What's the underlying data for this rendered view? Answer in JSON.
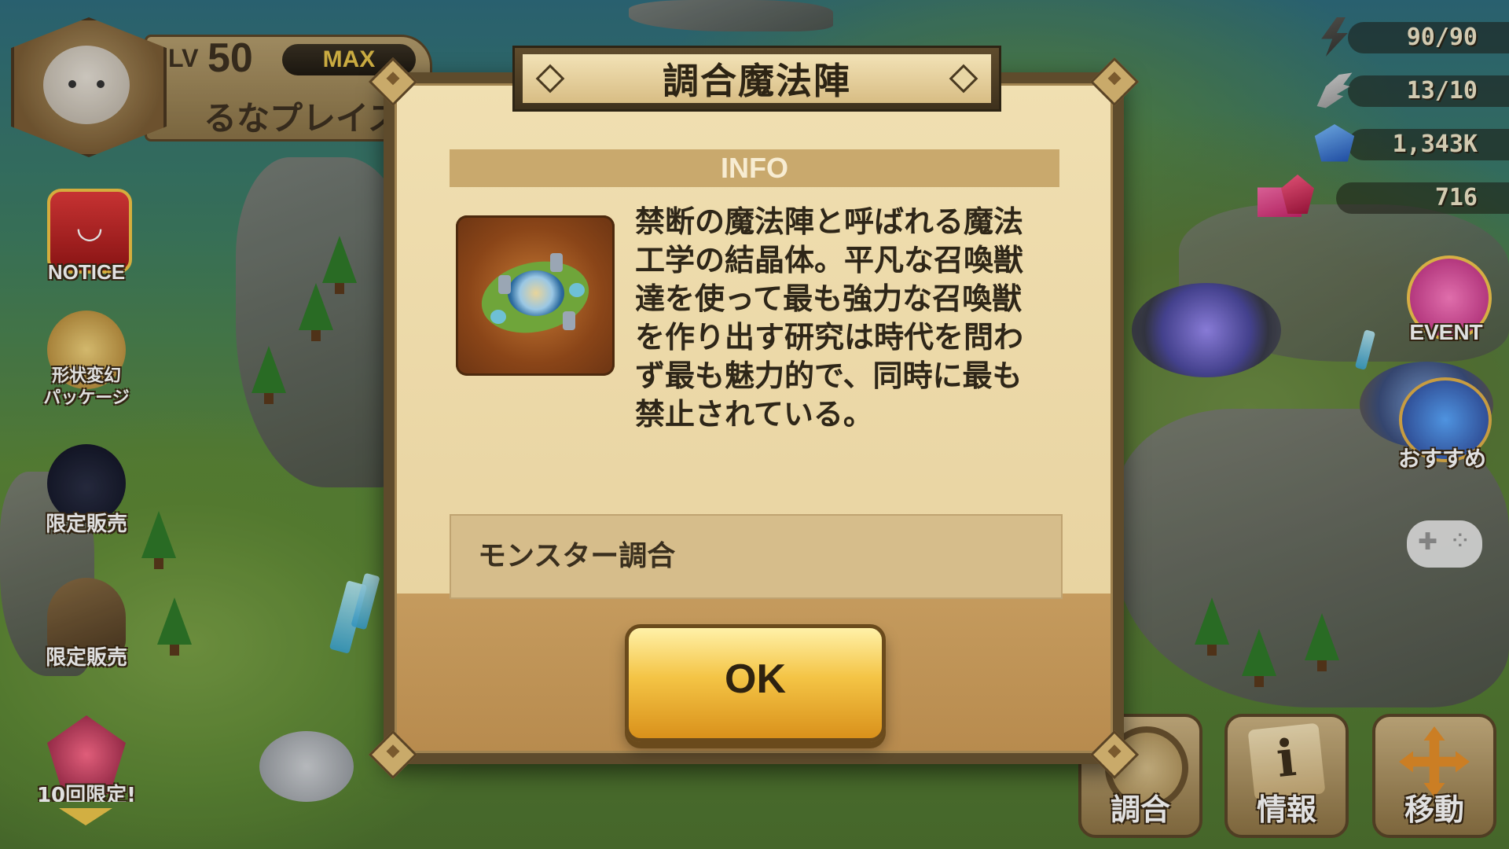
{
  "player": {
    "level_label": "LV",
    "level": "50",
    "max_badge": "MAX",
    "name": "るなプレイス"
  },
  "resources": {
    "energy": "90/90",
    "arena_wings": "13/10",
    "mana_crystals": "1,343K",
    "premium_crystals": "716"
  },
  "side_menu": [
    {
      "label": "NOTICE",
      "icon": "notice-icon"
    },
    {
      "label": "形状変幻\nパッケージ",
      "icon": "shape-shift-icon"
    },
    {
      "label": "限定販売",
      "icon": "dragon-icon"
    },
    {
      "label": "限定販売",
      "icon": "rune-icon"
    },
    {
      "label": "10回限定!",
      "icon": "gem-icon"
    }
  ],
  "right_menu": {
    "event_label": "EVENT",
    "recommend_label": "おすすめ"
  },
  "actions": {
    "fuse_label": "調合",
    "info_label": "情報",
    "move_label": "移動"
  },
  "dialog": {
    "title": "調合魔法陣",
    "info_header": "INFO",
    "item_icon": "fusion-magic-circle-icon",
    "description": "禁断の魔法陣と呼ばれる魔法\n工学の結晶体。平凡な召喚獣\n達を使って最も強力な召喚獣\nを作り出す研究は時代を問わ\nず最も魅力的で、同時に最も\n禁止されている。",
    "feature": "モンスター調合",
    "ok_label": "OK"
  },
  "colors": {
    "dialog_background": "#f0dfb1",
    "dialog_border": "#5e4b2c",
    "ok_button": "#f4c445",
    "footer": "#c59b5e"
  }
}
